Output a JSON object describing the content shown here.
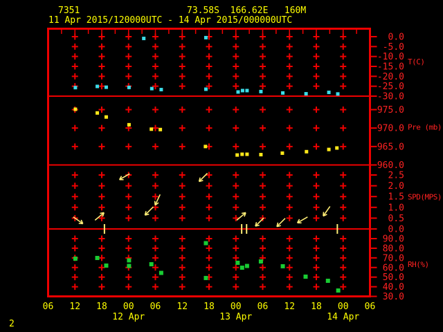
{
  "header": {
    "station_id": "7351",
    "position": "73.58S  166.62E   160M",
    "time_range": "11 Apr 2015/120000UTC - 14 Apr 2015/000000UTC"
  },
  "footer": {
    "page_number": "2"
  },
  "colors": {
    "background": "#000000",
    "axis_red": "#ee0000",
    "tick_label_red": "#ff2222",
    "text_yellow": "#ffff00",
    "temp_cyan": "#3cdce8",
    "pres_yellow": "#ffe81a",
    "wind_yellow": "#ffee77",
    "rh_green": "#19cc33"
  },
  "x_axis": {
    "time_unit": "hours UTC, axis from 11 Apr 2015 06UTC to 14 Apr 2015 06UTC, major tick every 6 h",
    "tick_labels": [
      "06",
      "12",
      "18",
      "00",
      "06",
      "12",
      "18",
      "00",
      "06",
      "12",
      "18",
      "00",
      "06"
    ],
    "date_labels": [
      {
        "label": "12 Apr",
        "tick_index": 3
      },
      {
        "label": "13 Apr",
        "tick_index": 7
      },
      {
        "label": "14 Apr",
        "tick_index": 11
      }
    ]
  },
  "chart_data": [
    {
      "type": "scatter",
      "name": "temperature",
      "ylabel": "T(C)",
      "ylim": [
        -30,
        0
      ],
      "tick_values": [
        0,
        -5,
        -10,
        -15,
        -20,
        -25,
        -30
      ],
      "tick_labels": [
        "0.0",
        "-5.0",
        "-10.0",
        "-15.0",
        "-20.0",
        "-25.0",
        "-30.0"
      ],
      "points": [
        {
          "t": 12.1,
          "v": -25.7
        },
        {
          "t": 17.0,
          "v": -25.1
        },
        {
          "t": 19.0,
          "v": -25.5
        },
        {
          "t": 24.1,
          "v": -25.6
        },
        {
          "t": 27.4,
          "v": -0.9
        },
        {
          "t": 29.2,
          "v": -26.2
        },
        {
          "t": 31.3,
          "v": -26.7
        },
        {
          "t": 41.3,
          "v": -26.5
        },
        {
          "t": 41.3,
          "v": -0.5
        },
        {
          "t": 48.5,
          "v": -27.9
        },
        {
          "t": 49.5,
          "v": -27.2
        },
        {
          "t": 50.5,
          "v": -27.2
        },
        {
          "t": 53.6,
          "v": -27.7
        },
        {
          "t": 58.5,
          "v": -28.4
        },
        {
          "t": 63.7,
          "v": -28.8
        },
        {
          "t": 68.8,
          "v": -28.1
        },
        {
          "t": 70.8,
          "v": -28.9
        }
      ]
    },
    {
      "type": "scatter",
      "name": "pressure",
      "ylabel": "Pre (mb)",
      "ylim": [
        960,
        975
      ],
      "tick_values": [
        975,
        970,
        965,
        960
      ],
      "tick_labels": [
        "975.0",
        "970.0",
        "965.0",
        "960.0"
      ],
      "points": [
        {
          "t": 12.1,
          "v": 975.1
        },
        {
          "t": 17.0,
          "v": 974.1
        },
        {
          "t": 19.0,
          "v": 973.0
        },
        {
          "t": 24.1,
          "v": 970.9
        },
        {
          "t": 29.1,
          "v": 969.7
        },
        {
          "t": 31.1,
          "v": 969.6
        },
        {
          "t": 41.2,
          "v": 965.0
        },
        {
          "t": 48.3,
          "v": 962.7
        },
        {
          "t": 49.4,
          "v": 962.9
        },
        {
          "t": 50.5,
          "v": 962.9
        },
        {
          "t": 53.6,
          "v": 962.8
        },
        {
          "t": 58.4,
          "v": 963.2
        },
        {
          "t": 63.8,
          "v": 963.6
        },
        {
          "t": 68.8,
          "v": 964.2
        },
        {
          "t": 70.6,
          "v": 964.6
        }
      ]
    },
    {
      "type": "wind-arrows",
      "name": "wind-speed-direction",
      "ylabel": "SPD(MPS)",
      "ylim": [
        0,
        2.5
      ],
      "tick_values": [
        2.5,
        2.0,
        1.5,
        1.0,
        0.5,
        0.0
      ],
      "tick_labels": [
        "2.5",
        "2.0",
        "1.5",
        "1.0",
        "0.5",
        "0.0"
      ],
      "arrows": [
        {
          "t": 12.7,
          "speed": 0.4,
          "angle_deg": 35
        },
        {
          "t": 17.5,
          "speed": 0.58,
          "angle_deg": 320
        },
        {
          "t": 23.1,
          "speed": 2.42,
          "angle_deg": 150
        },
        {
          "t": 28.6,
          "speed": 0.83,
          "angle_deg": 135
        },
        {
          "t": 30.5,
          "speed": 1.35,
          "angle_deg": 115
        },
        {
          "t": 40.7,
          "speed": 2.39,
          "angle_deg": 135
        },
        {
          "t": 49.2,
          "speed": 0.58,
          "angle_deg": 320
        },
        {
          "t": 53.3,
          "speed": 0.32,
          "angle_deg": 135
        },
        {
          "t": 58.1,
          "speed": 0.3,
          "angle_deg": 135
        },
        {
          "t": 62.9,
          "speed": 0.42,
          "angle_deg": 150
        },
        {
          "t": 68.3,
          "speed": 0.82,
          "angle_deg": 125
        }
      ],
      "calm_marks_t": [
        18.6,
        49.3,
        50.4,
        70.7
      ]
    },
    {
      "type": "scatter",
      "name": "relative-humidity",
      "ylabel": "RH(%)",
      "ylim": [
        30,
        90
      ],
      "tick_values": [
        90,
        80,
        70,
        60,
        50,
        40,
        30
      ],
      "tick_labels": [
        "90.0",
        "80.0",
        "70.0",
        "60.0",
        "50.0",
        "40.0",
        "30.0"
      ],
      "points": [
        {
          "t": 12.1,
          "v": 69.2
        },
        {
          "t": 17.0,
          "v": 69.9
        },
        {
          "t": 19.0,
          "v": 62.0
        },
        {
          "t": 24.1,
          "v": 67.4
        },
        {
          "t": 24.1,
          "v": 61.6
        },
        {
          "t": 29.1,
          "v": 63.4
        },
        {
          "t": 31.3,
          "v": 54.4
        },
        {
          "t": 41.3,
          "v": 85.3
        },
        {
          "t": 41.3,
          "v": 49.1
        },
        {
          "t": 48.4,
          "v": 64.9
        },
        {
          "t": 49.4,
          "v": 59.8
        },
        {
          "t": 50.5,
          "v": 61.6
        },
        {
          "t": 53.6,
          "v": 66.3
        },
        {
          "t": 58.5,
          "v": 61.3
        },
        {
          "t": 63.6,
          "v": 50.5
        },
        {
          "t": 68.6,
          "v": 46.2
        },
        {
          "t": 70.9,
          "v": 36.1
        }
      ]
    }
  ]
}
